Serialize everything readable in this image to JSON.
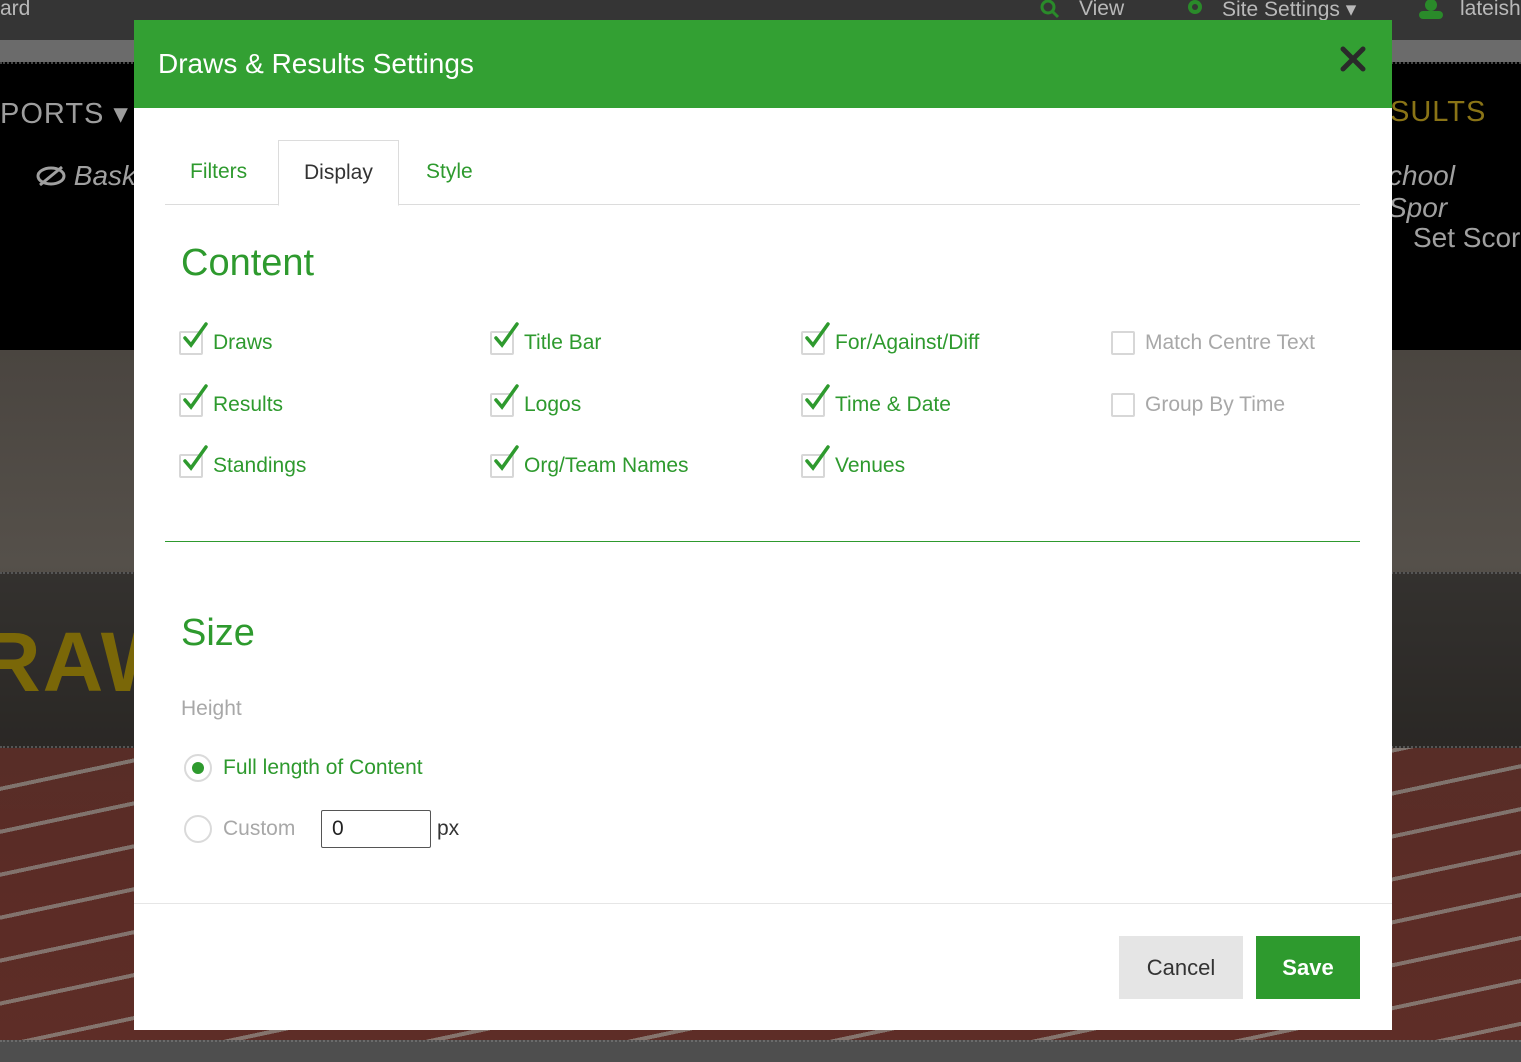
{
  "background": {
    "topbar": {
      "left_text": "ard",
      "view_label": "View",
      "site_settings_label": "Site Settings ▾",
      "user_label": "lateish"
    },
    "nav": {
      "sports_menu": "PORTS ▾",
      "results_menu": "SULTS",
      "basketball_link": "Bask",
      "school_sports_link": "chool Spor",
      "set_scores_link": "Set Scor"
    },
    "hero_text": "RAW"
  },
  "modal": {
    "title": "Draws & Results Settings",
    "close_icon": "close-icon",
    "tabs": [
      {
        "label": "Filters",
        "active": false
      },
      {
        "label": "Display",
        "active": true
      },
      {
        "label": "Style",
        "active": false
      }
    ],
    "content": {
      "title": "Content",
      "options": [
        {
          "label": "Draws",
          "checked": true
        },
        {
          "label": "Results",
          "checked": true
        },
        {
          "label": "Standings",
          "checked": true
        },
        {
          "label": "Title Bar",
          "checked": true
        },
        {
          "label": "Logos",
          "checked": true
        },
        {
          "label": "Org/Team Names",
          "checked": true
        },
        {
          "label": "For/Against/Diff",
          "checked": true
        },
        {
          "label": "Time & Date",
          "checked": true
        },
        {
          "label": "Venues",
          "checked": true
        },
        {
          "label": "Match Centre Text",
          "checked": false
        },
        {
          "label": "Group By Time",
          "checked": false
        }
      ]
    },
    "size": {
      "title": "Size",
      "height_label": "Height",
      "options": [
        {
          "label": "Full length of Content",
          "selected": true
        },
        {
          "label": "Custom",
          "selected": false
        }
      ],
      "custom_value": "0",
      "unit": "px"
    },
    "buttons": {
      "cancel": "Cancel",
      "save": "Save"
    },
    "colors": {
      "accent": "#33a033",
      "header": "#33a033"
    }
  }
}
